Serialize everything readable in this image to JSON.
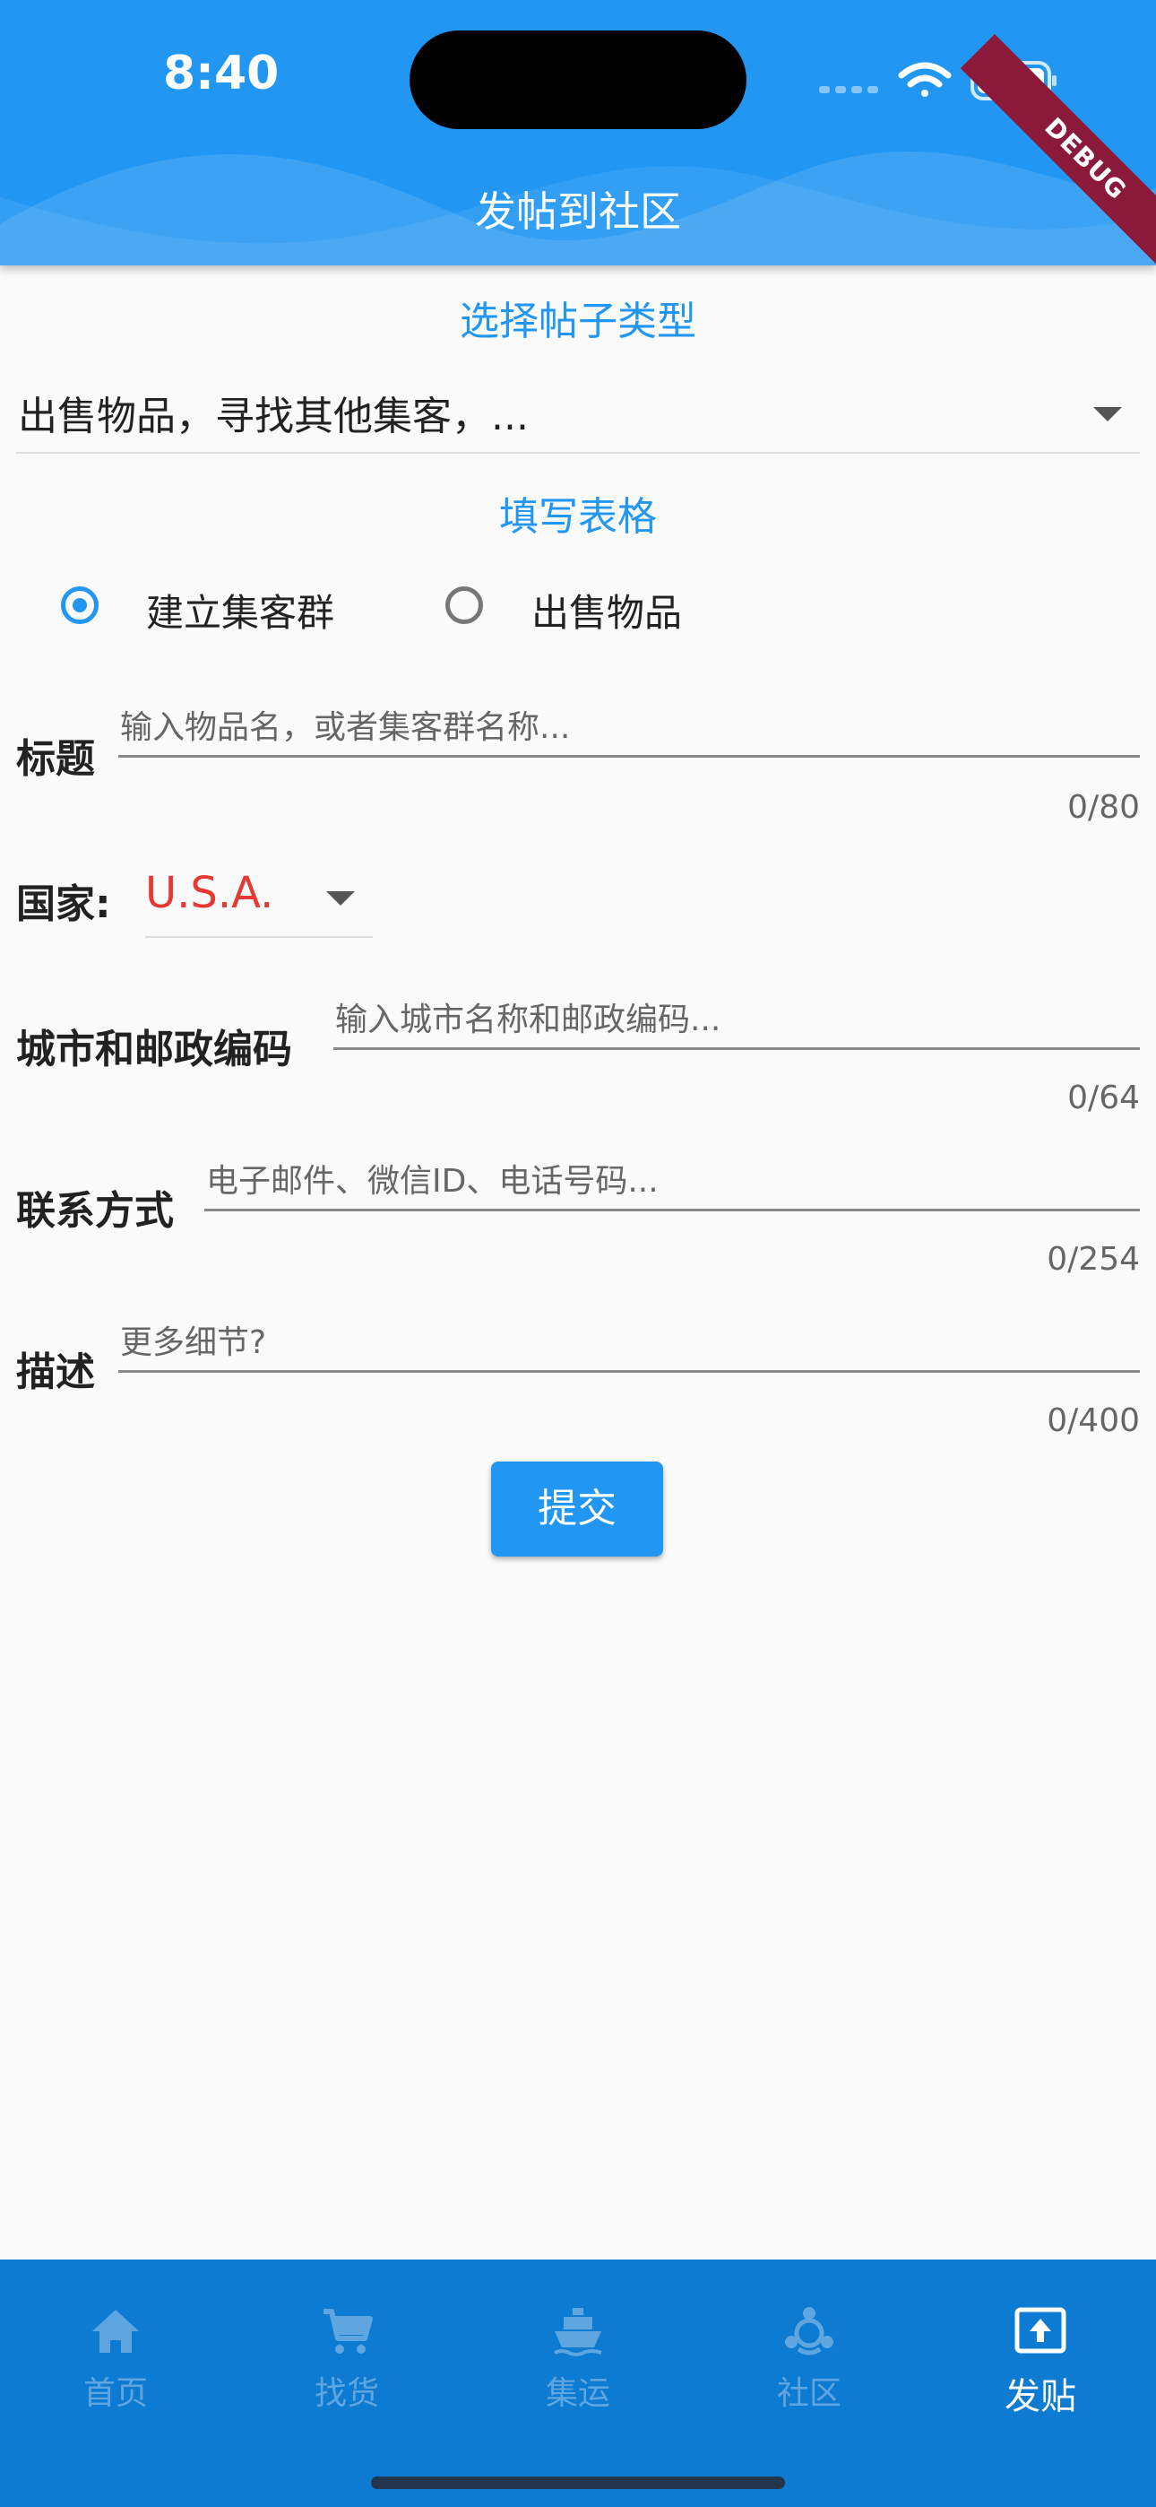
{
  "status_bar": {
    "time": "8:40"
  },
  "header": {
    "title": "发帖到社区",
    "debug_banner": "DEBUG"
  },
  "post_type": {
    "section_title": "选择帖子类型",
    "selected_value": "出售物品，寻找其他集客，..."
  },
  "form": {
    "section_title": "填写表格",
    "radio_options": [
      {
        "label": "建立集客群",
        "selected": true
      },
      {
        "label": "出售物品",
        "selected": false
      }
    ],
    "title_field": {
      "label": "标题",
      "placeholder": "输入物品名，或者集客群名称...",
      "counter": "0/80"
    },
    "country": {
      "label": "国家:",
      "value": "U.S.A."
    },
    "city_field": {
      "label": "城市和邮政编码",
      "placeholder": "输入城市名称和邮政编码...",
      "counter": "0/64"
    },
    "contact_field": {
      "label": "联系方式",
      "placeholder": "电子邮件、微信ID、电话号码...",
      "counter": "0/254"
    },
    "description_field": {
      "label": "描述",
      "placeholder": "更多细节?",
      "counter": "0/400"
    },
    "submit_label": "提交"
  },
  "bottom_nav": {
    "items": [
      {
        "label": "首页",
        "icon": "home-icon",
        "active": false
      },
      {
        "label": "找货",
        "icon": "cart-icon",
        "active": false
      },
      {
        "label": "集运",
        "icon": "ship-icon",
        "active": false
      },
      {
        "label": "社区",
        "icon": "community-icon",
        "active": false
      },
      {
        "label": "发贴",
        "icon": "post-upload-icon",
        "active": true
      }
    ]
  },
  "colors": {
    "primary": "#2196f3",
    "nav_background": "#0d7bd1",
    "country_value": "#e53935",
    "debug_banner": "#8b1a3a"
  }
}
